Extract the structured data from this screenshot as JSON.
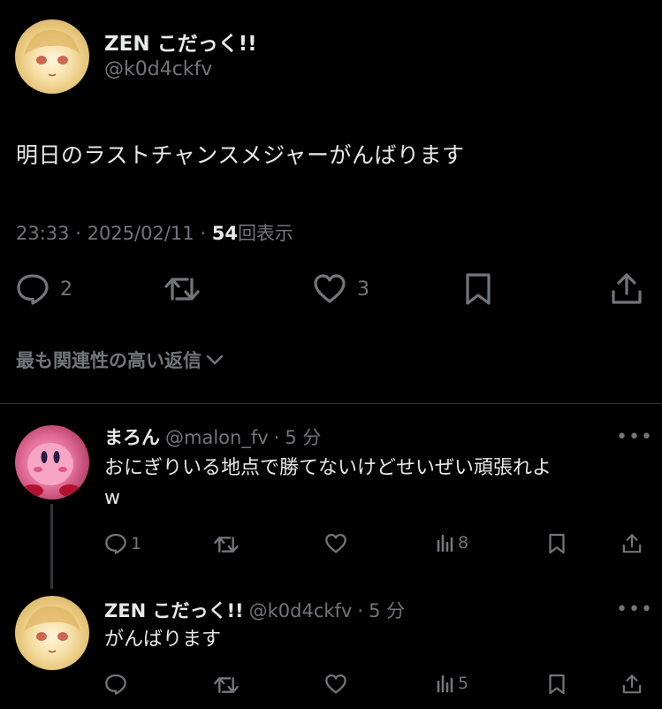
{
  "main_tweet": {
    "display_name": "ZEN こだっく!!",
    "handle": "@k0d4ckfv",
    "text": "明日のラストチャンスメジャーがんばります",
    "time": "23:33",
    "date": "2025/02/11",
    "views_count": "54",
    "views_label": "回表示",
    "replies": "2",
    "likes": "3"
  },
  "sort_label": "最も関連性の高い返信",
  "replies": [
    {
      "display_name": "まろん",
      "handle": "@malon_fv",
      "time_ago": "5 分",
      "text_line1": "おにぎりいる地点で勝てないけどせいぜい頑張れよ",
      "text_line2": "w",
      "reply_count": "1",
      "views": "8"
    },
    {
      "display_name": "ZEN こだっく!!",
      "handle": "@k0d4ckfv",
      "time_ago": "5 分",
      "text_line1": "がんばります",
      "views": "5"
    }
  ],
  "separator": "·",
  "more": "•••",
  "colors": {
    "background": "#000000",
    "text": "#e7e9ea",
    "muted": "#71767b",
    "divider": "#2f3336"
  }
}
